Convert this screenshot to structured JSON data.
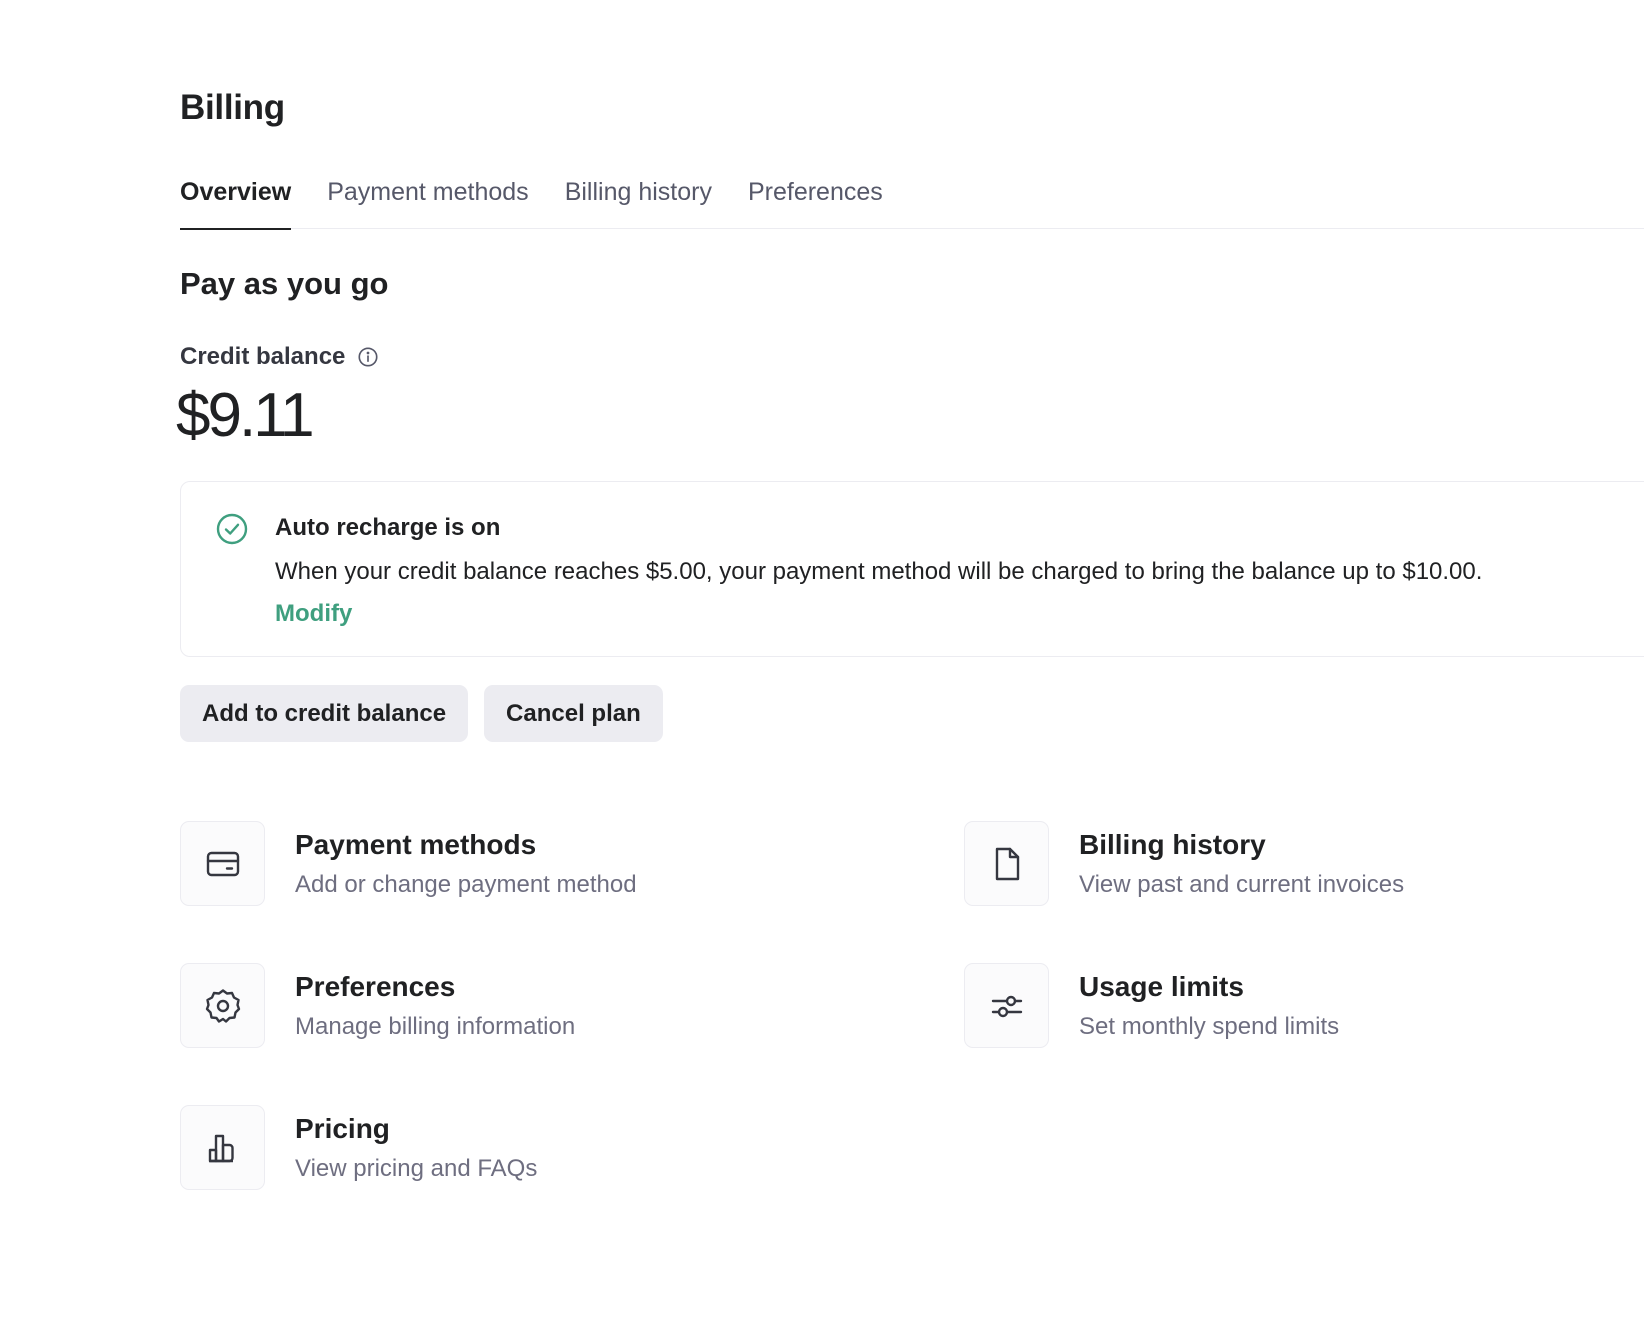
{
  "page": {
    "title": "Billing"
  },
  "tabs": [
    {
      "label": "Overview",
      "active": true
    },
    {
      "label": "Payment methods",
      "active": false
    },
    {
      "label": "Billing history",
      "active": false
    },
    {
      "label": "Preferences",
      "active": false
    }
  ],
  "plan": {
    "title": "Pay as you go",
    "balance_label": "Credit balance",
    "balance_info_icon": "info-icon",
    "balance_amount": "$9.11"
  },
  "auto_recharge": {
    "icon": "check-circle-icon",
    "title": "Auto recharge is on",
    "description": "When your credit balance reaches $5.00, your payment method will be charged to bring the balance up to $10.00.",
    "link_label": "Modify",
    "accent_color": "#3f9f7f"
  },
  "actions": {
    "add_credit_label": "Add to credit balance",
    "cancel_plan_label": "Cancel plan"
  },
  "cards": [
    {
      "icon": "credit-card-icon",
      "title": "Payment methods",
      "subtitle": "Add or change payment method"
    },
    {
      "icon": "document-icon",
      "title": "Billing history",
      "subtitle": "View past and current invoices"
    },
    {
      "icon": "gear-icon",
      "title": "Preferences",
      "subtitle": "Manage billing information"
    },
    {
      "icon": "sliders-icon",
      "title": "Usage limits",
      "subtitle": "Set monthly spend limits"
    },
    {
      "icon": "bar-chart-icon",
      "title": "Pricing",
      "subtitle": "View pricing and FAQs"
    }
  ]
}
